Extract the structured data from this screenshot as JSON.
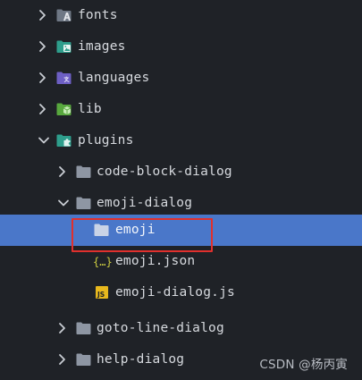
{
  "file_tree": {
    "items": [
      {
        "label": "fonts",
        "icon": "font-folder-icon",
        "expanded": false
      },
      {
        "label": "images",
        "icon": "images-folder-icon",
        "expanded": false
      },
      {
        "label": "languages",
        "icon": "languages-folder-icon",
        "expanded": false
      },
      {
        "label": "lib",
        "icon": "lib-folder-icon",
        "expanded": false
      },
      {
        "label": "plugins",
        "icon": "plugins-folder-icon",
        "expanded": true
      },
      {
        "label": "code-block-dialog",
        "icon": "folder-icon",
        "expanded": false
      },
      {
        "label": "emoji-dialog",
        "icon": "folder-open-icon",
        "expanded": true
      },
      {
        "label": "emoji",
        "icon": "folder-icon",
        "selected": true
      },
      {
        "label": "emoji.json",
        "icon": "json-file-icon"
      },
      {
        "label": "emoji-dialog.js",
        "icon": "js-file-icon"
      },
      {
        "label": "goto-line-dialog",
        "icon": "folder-icon",
        "expanded": false
      },
      {
        "label": "help-dialog",
        "icon": "folder-icon",
        "expanded": false
      }
    ]
  },
  "watermark": "CSDN @杨丙寅",
  "colors": {
    "background": "#1f2227",
    "selection": "#4a77c9",
    "annotation_border": "#e0302d",
    "folder_gray": "#8e96a3",
    "folder_teal": "#2e9e8c",
    "folder_purple": "#6d5fc4",
    "lib_green": "#58a83e",
    "json_yellow": "#cbcb41",
    "js_yellow": "#e8b81d"
  }
}
